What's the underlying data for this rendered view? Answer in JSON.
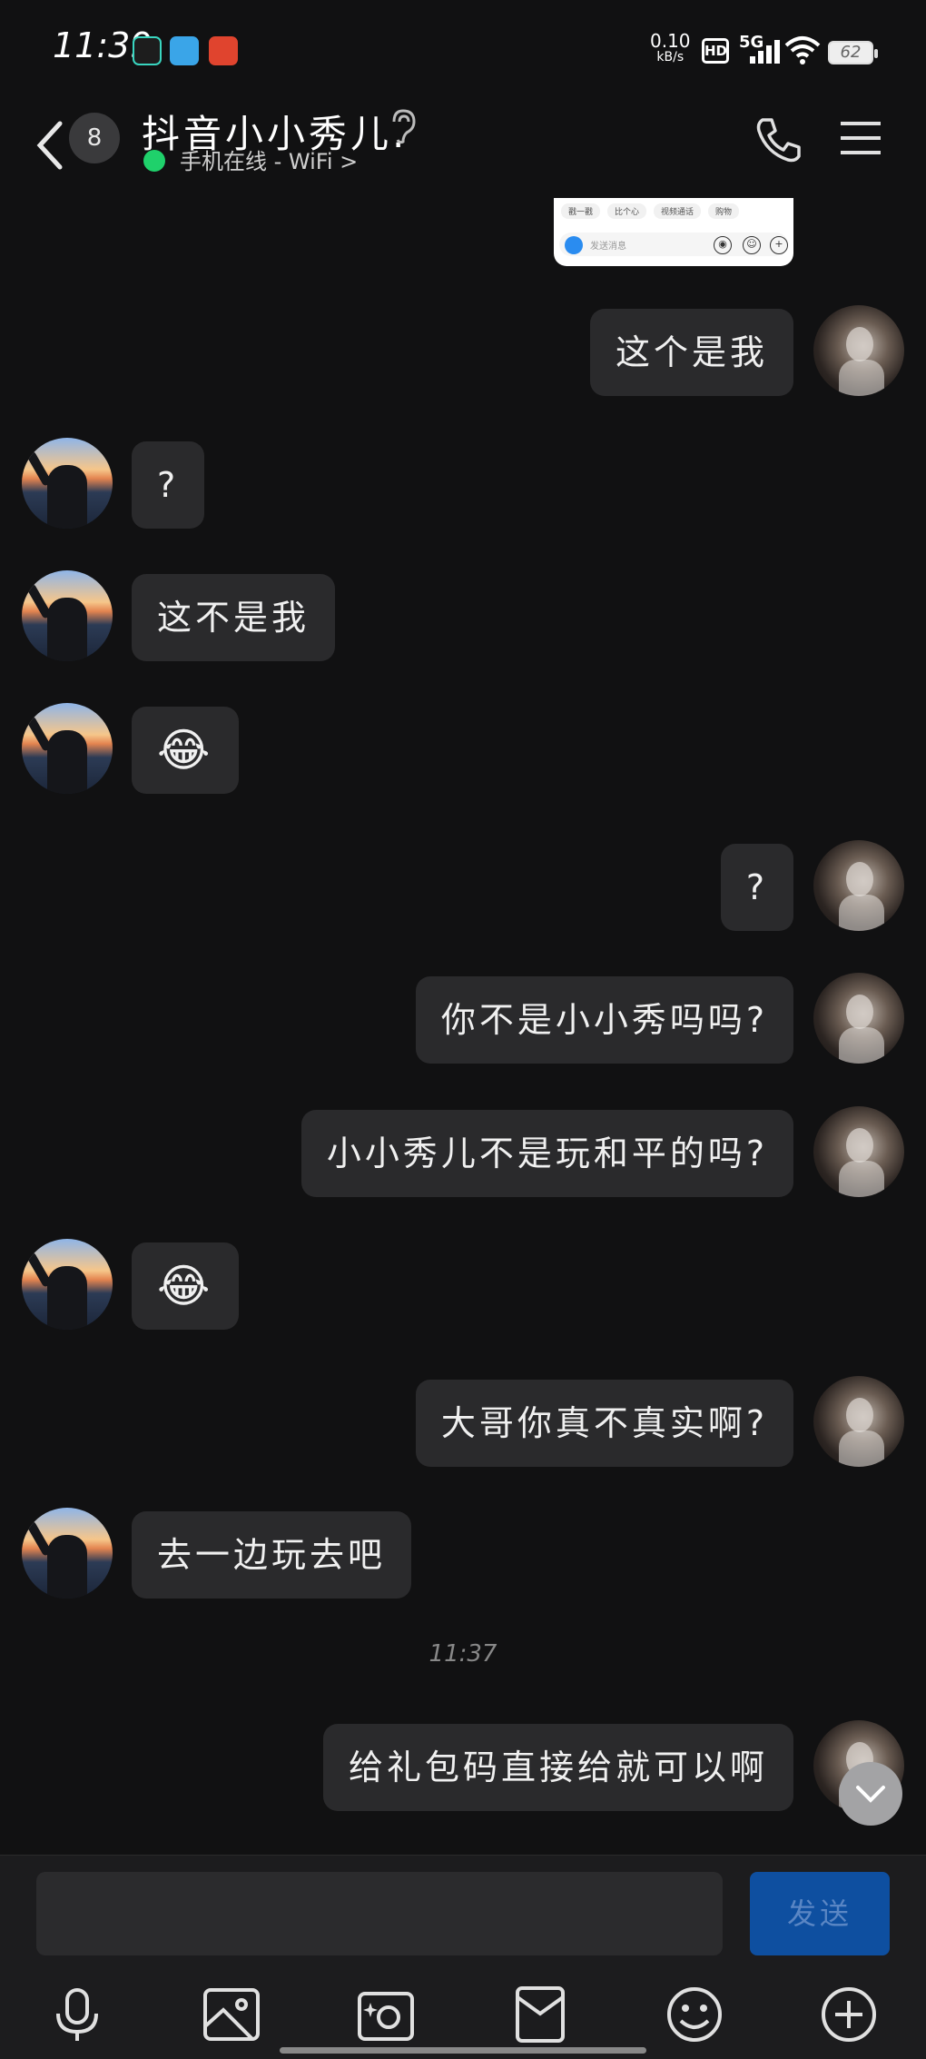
{
  "status_bar": {
    "time": "11:39",
    "net_speed": "0.10",
    "net_unit": "kB/s",
    "hd": "HD",
    "network": "5G",
    "battery": "62"
  },
  "header": {
    "unread_count": "8",
    "title": "抖音小小秀儿.",
    "status": "手机在线 - WiFi >"
  },
  "preview": {
    "chips": [
      "戳一戳",
      "比个心",
      "视频通话",
      "购物"
    ],
    "placeholder": "发送消息"
  },
  "messages": [
    {
      "side": "right",
      "text": "这个是我"
    },
    {
      "side": "left",
      "text": "?"
    },
    {
      "side": "left",
      "text": "这不是我"
    },
    {
      "side": "left",
      "text": "😂"
    },
    {
      "side": "right",
      "text": "?"
    },
    {
      "side": "right",
      "text": "你不是小小秀吗吗?"
    },
    {
      "side": "right",
      "text": "小小秀儿不是玩和平的吗?"
    },
    {
      "side": "left",
      "text": "😂"
    },
    {
      "side": "right",
      "text": "大哥你真不真实啊?"
    },
    {
      "side": "left",
      "text": "去一边玩去吧"
    },
    {
      "side": "right",
      "text": "给礼包码直接给就可以啊"
    }
  ],
  "timestamp": "11:37",
  "composer": {
    "placeholder": "",
    "send_label": "发送"
  },
  "toolbar_icons": [
    "microphone-icon",
    "image-icon",
    "camera-icon",
    "red-packet-icon",
    "emoji-icon",
    "plus-icon"
  ]
}
